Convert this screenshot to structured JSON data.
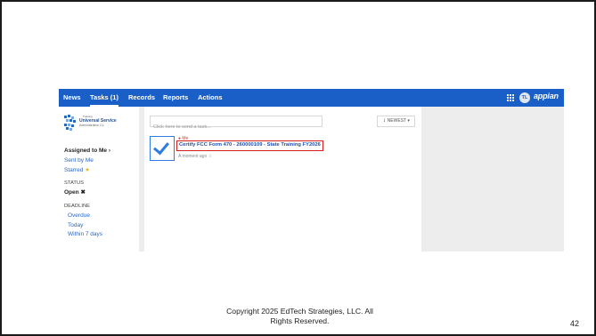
{
  "nav": {
    "tabs": [
      {
        "label": "News"
      },
      {
        "label": "Tasks (1)"
      },
      {
        "label": "Records"
      },
      {
        "label": "Reports"
      },
      {
        "label": "Actions"
      }
    ],
    "avatar_initials": "TL",
    "brand": "appian",
    "accent_color": "#1a5fc8"
  },
  "sidebar": {
    "logo": {
      "small": "Training",
      "title": "Universal Service",
      "subtitle": "Administrative Co."
    },
    "assigned_label": "Assigned to Me ›",
    "sent_label": "Sent by Me",
    "starred_label": "Starred",
    "starred_icon": "★",
    "status_heading": "STATUS",
    "status_value": "Open",
    "status_clear_icon": "✖",
    "deadline_heading": "DEADLINE",
    "deadline_options": [
      "Overdue",
      "Today",
      "Within 7 days"
    ]
  },
  "main": {
    "send_task_placeholder": "Click here to send a task...",
    "sort_label": "⇂ NEWEST ▾",
    "task": {
      "assignee": "● Me",
      "title": "Certify FCC Form 470 - 260000109 - State Training FY2026",
      "time": "A moment ago",
      "star_icon": "☆"
    }
  },
  "footer": {
    "copyright_line1": "Copyright 2025 EdTech Strategies, LLC.  All",
    "copyright_line2": "Rights Reserved.",
    "page_number": "42"
  }
}
